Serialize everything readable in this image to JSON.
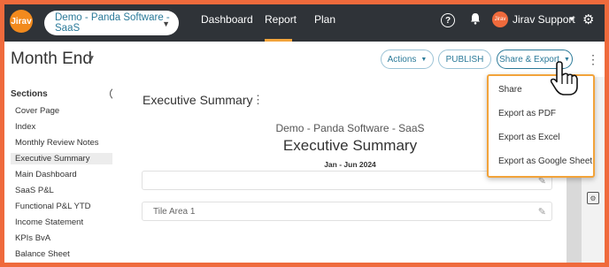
{
  "brand": {
    "logo_text": "Jirav",
    "accent": "#ef6a3c",
    "highlight": "#f2a33a",
    "topbar_bg": "#2f3338",
    "link_color": "#2b7a99"
  },
  "company_selector": {
    "value": "Demo - Panda Software - SaaS"
  },
  "nav": {
    "items": [
      "Dashboard",
      "Report",
      "Plan"
    ],
    "active": "Report"
  },
  "user": {
    "avatar_text": "Jirav",
    "name": "Jirav Support"
  },
  "icons": {
    "help": "help-icon",
    "notifications": "bell-icon",
    "settings": "gear-icon",
    "add_section": "add-icon",
    "more": "more-vert-icon",
    "edit": "pencil-icon"
  },
  "page": {
    "title": "Month End"
  },
  "toolbar": {
    "actions_label": "Actions",
    "publish_label": "PUBLISH",
    "share_export_label": "Share & Export"
  },
  "sidebar": {
    "heading": "Sections",
    "items": [
      "Cover Page",
      "Index",
      "Monthly Review Notes",
      "Executive Summary",
      "Main Dashboard",
      "SaaS P&L",
      "Functional P&L YTD",
      "Income Statement",
      "KPIs BvA",
      "Balance Sheet"
    ],
    "active": "Executive Summary"
  },
  "content": {
    "section_title": "Executive Summary",
    "company_line": "Demo - Panda Software - SaaS",
    "report_heading": "Executive Summary",
    "period": "Jan - Jun 2024",
    "tiles": [
      "",
      "Tile Area 1"
    ]
  },
  "dropdown": {
    "items": [
      "Share",
      "Export as PDF",
      "Export as Excel",
      "Export as Google Sheet"
    ]
  }
}
